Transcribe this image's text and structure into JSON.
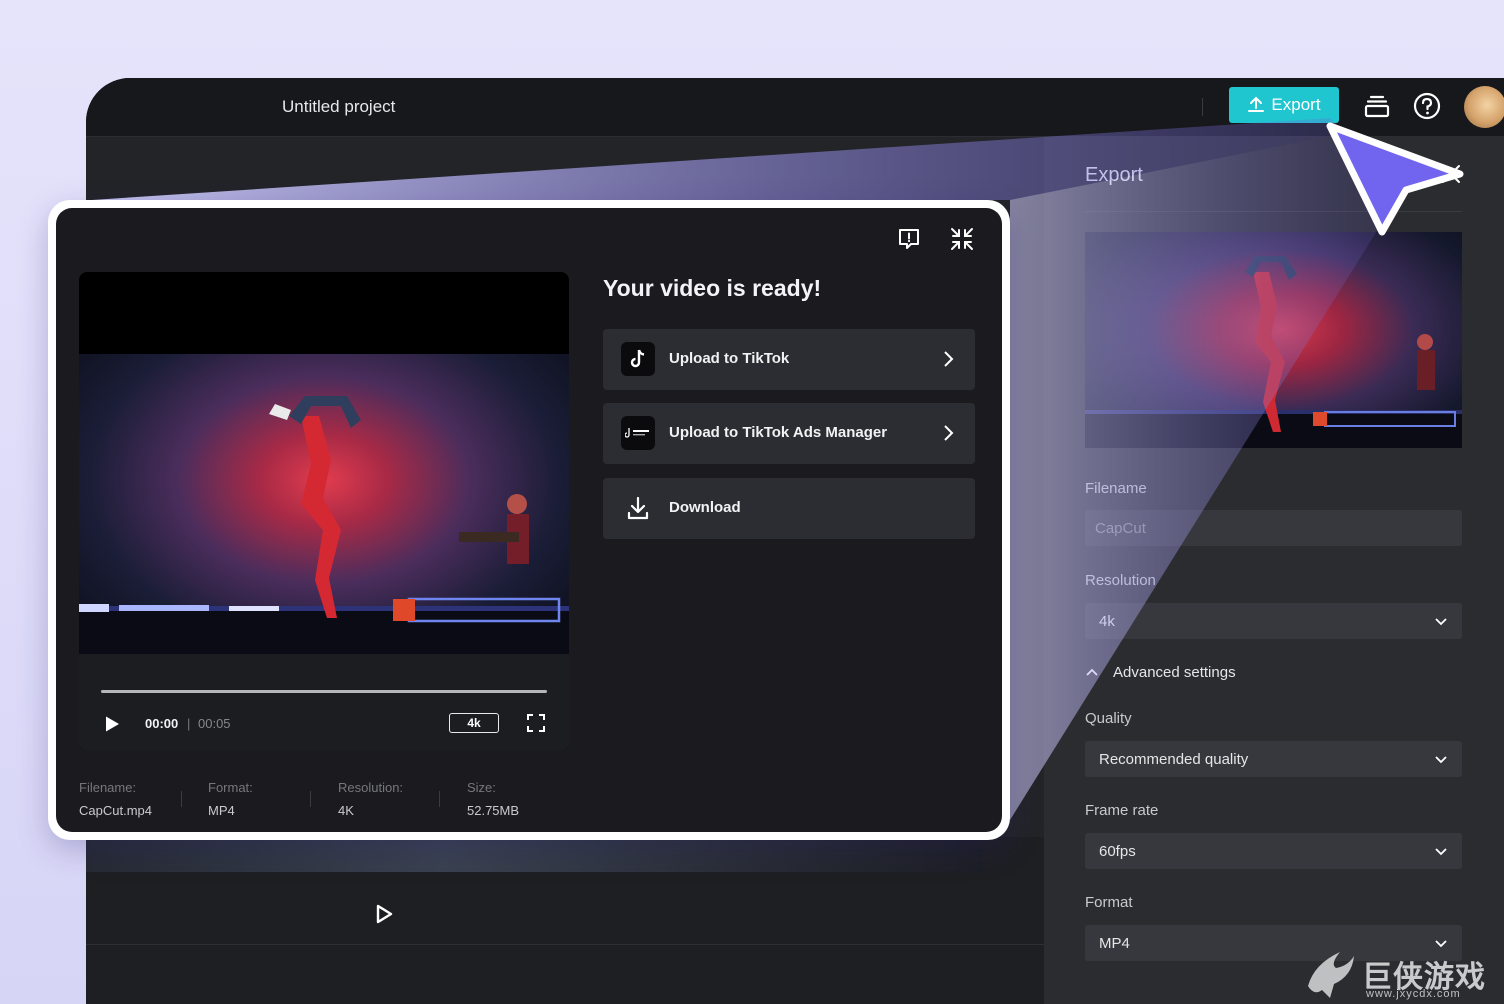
{
  "topbar": {
    "project_title": "Untitled project",
    "export_label": "Export",
    "icons": [
      "upload-icon",
      "layers-icon",
      "help-icon",
      "avatar"
    ]
  },
  "export_panel": {
    "title": "Export",
    "filename_label": "Filename",
    "filename_value": "CapCut",
    "resolution_label": "Resolution",
    "resolution_value": "4k",
    "advanced_label": "Advanced settings",
    "quality_label": "Quality",
    "quality_value": "Recommended quality",
    "frame_rate_label": "Frame rate",
    "frame_rate_value": "60fps",
    "format_label": "Format",
    "format_value": "MP4"
  },
  "modal": {
    "title": "Your video is ready!",
    "actions": [
      {
        "label": "Upload to TikTok",
        "icon": "tiktok-icon"
      },
      {
        "label": "Upload to TikTok Ads Manager",
        "icon": "tiktok-business-icon"
      },
      {
        "label": "Download",
        "icon": "download-icon"
      }
    ],
    "player": {
      "current_time": "00:00",
      "separator": "|",
      "duration": "00:05",
      "resolution_badge": "4k"
    },
    "meta": [
      {
        "key": "Filename:",
        "value": "CapCut.mp4"
      },
      {
        "key": "Format:",
        "value": "MP4"
      },
      {
        "key": "Resolution:",
        "value": "4K"
      },
      {
        "key": "Size:",
        "value": "52.75MB"
      }
    ]
  },
  "watermark": {
    "text": "巨侠游戏",
    "url": "www.jxycdx.com"
  },
  "colors": {
    "accent": "#1fc5cf",
    "cursor": "#7165f0",
    "panel_bg": "#2b2c30",
    "modal_bg": "#1b1b1f"
  }
}
